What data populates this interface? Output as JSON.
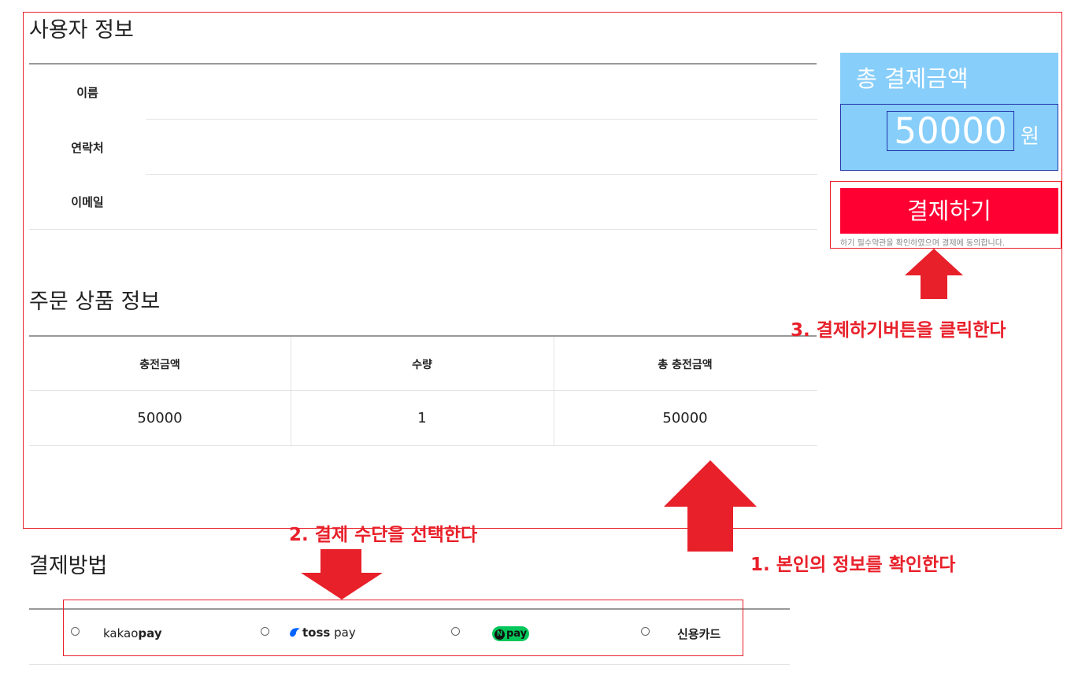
{
  "user_section": {
    "title": "사용자 정보",
    "fields": [
      {
        "label": "이름",
        "value": ""
      },
      {
        "label": "연락처",
        "value": ""
      },
      {
        "label": "이메일",
        "value": ""
      }
    ]
  },
  "order_section": {
    "title": "주문 상품 정보",
    "columns": [
      "충전금액",
      "수량",
      "총 충전금액"
    ],
    "rows": [
      [
        "50000",
        "1",
        "50000"
      ]
    ]
  },
  "summary": {
    "title": "총 결제금액",
    "amount": "50000",
    "unit": "원",
    "pay_button": "결제하기",
    "agreement": "하기 필수약관을 확인하였으며 결제에 동의합니다."
  },
  "payment_section": {
    "title": "결제방법",
    "options": [
      {
        "brand_a": "kakao",
        "brand_b": "pay",
        "icon": "kakaopay-logo",
        "selected": false
      },
      {
        "brand_a": "toss",
        "brand_b": "pay",
        "icon": "tosspay-logo",
        "selected": false
      },
      {
        "brand_a": "N",
        "brand_b": "pay",
        "icon": "naverpay-logo",
        "selected": false
      },
      {
        "label": "신용카드",
        "selected": false
      }
    ]
  },
  "annotations": {
    "step1": "1. 본인의 정보를 확인한다",
    "step2": "2. 결제 수단을 선택한다",
    "step3": "3. 결제하기버튼을 클릭한다"
  },
  "colors": {
    "annotation_red": "#e8202a",
    "summary_bg": "#87cefa",
    "pay_button_bg": "#ff0033",
    "naverpay_green": "#03c75a",
    "tosspay_blue": "#0064ff"
  }
}
